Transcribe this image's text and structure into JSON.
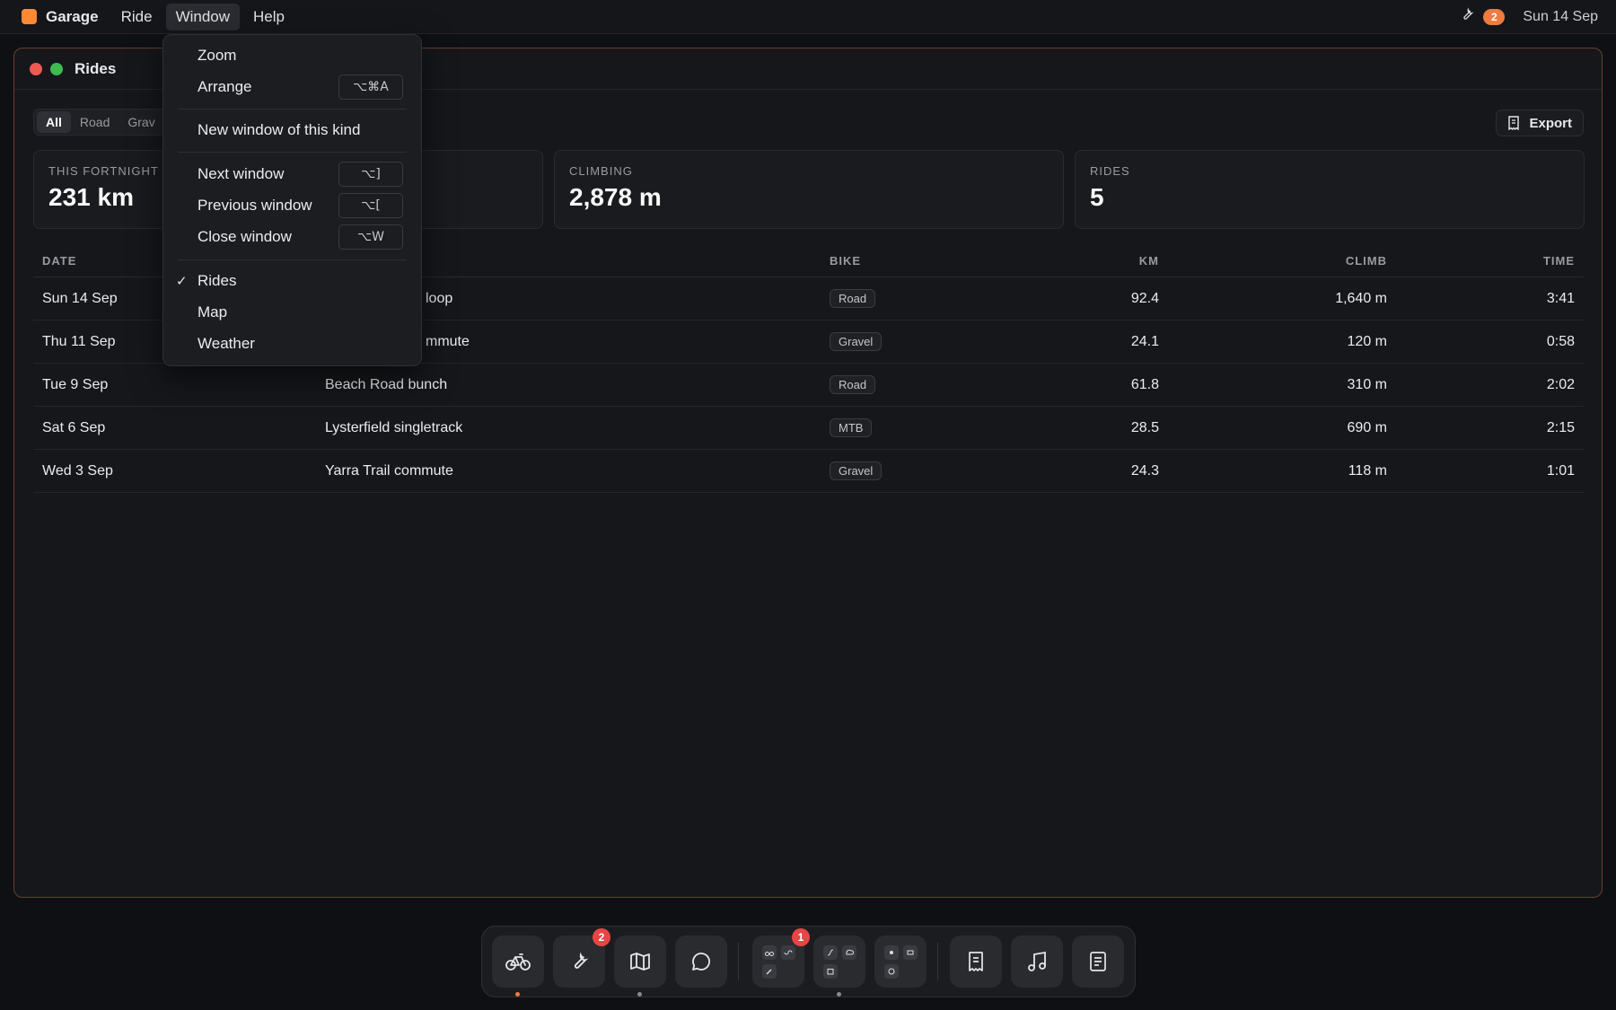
{
  "menubar": {
    "app_name": "Garage",
    "menus": [
      "Ride",
      "Window",
      "Help"
    ],
    "badge_count": "2",
    "date": "Sun 14 Sep"
  },
  "window": {
    "title": "Rides",
    "filters": [
      "All",
      "Road",
      "Grav"
    ],
    "export_label": "Export",
    "stats": [
      {
        "label": "THIS FORTNIGHT",
        "value": "231 km"
      },
      {
        "label": "CLIMBING",
        "value": "2,878 m"
      },
      {
        "label": "RIDES",
        "value": "5"
      }
    ],
    "table": {
      "headers": {
        "date": "DATE",
        "bike": "BIKE",
        "km": "KM",
        "climb": "CLIMB",
        "time": "TIME"
      },
      "rows": [
        {
          "date": "Sun 14 Sep",
          "name": "loop",
          "bike": "Road",
          "km": "92.4",
          "climb": "1,640 m",
          "time": "3:41"
        },
        {
          "date": "Thu 11 Sep",
          "name": "mmute",
          "bike": "Gravel",
          "km": "24.1",
          "climb": "120 m",
          "time": "0:58"
        },
        {
          "date": "Tue 9 Sep",
          "name": "Beach Road bunch",
          "bike": "Road",
          "km": "61.8",
          "climb": "310 m",
          "time": "2:02"
        },
        {
          "date": "Sat 6 Sep",
          "name": "Lysterfield singletrack",
          "bike": "MTB",
          "km": "28.5",
          "climb": "690 m",
          "time": "2:15"
        },
        {
          "date": "Wed 3 Sep",
          "name": "Yarra Trail commute",
          "bike": "Gravel",
          "km": "24.3",
          "climb": "118 m",
          "time": "1:01"
        }
      ]
    }
  },
  "window_menu": {
    "zoom": "Zoom",
    "arrange": "Arrange",
    "arrange_shortcut": "⌥⌘A",
    "new_window": "New window of this kind",
    "next_window": "Next window",
    "next_shortcut": "⌥]",
    "previous_window": "Previous window",
    "previous_shortcut": "⌥[",
    "close_window": "Close window",
    "close_shortcut": "⌥W",
    "check": "✓",
    "windows": [
      "Rides",
      "Map",
      "Weather"
    ]
  },
  "dock": {
    "wrench_badge": "2",
    "group_badge": "1",
    "icons": [
      "bike-icon",
      "wrench-icon",
      "map-icon",
      "chat-icon",
      "rides-group-icon",
      "routes-group-icon",
      "weather-group-icon",
      "receipt-icon",
      "music-icon",
      "notes-icon"
    ]
  },
  "colors": {
    "accent": "#ff8a33",
    "badge": "#e84545",
    "window_border": "#6a3f28"
  }
}
